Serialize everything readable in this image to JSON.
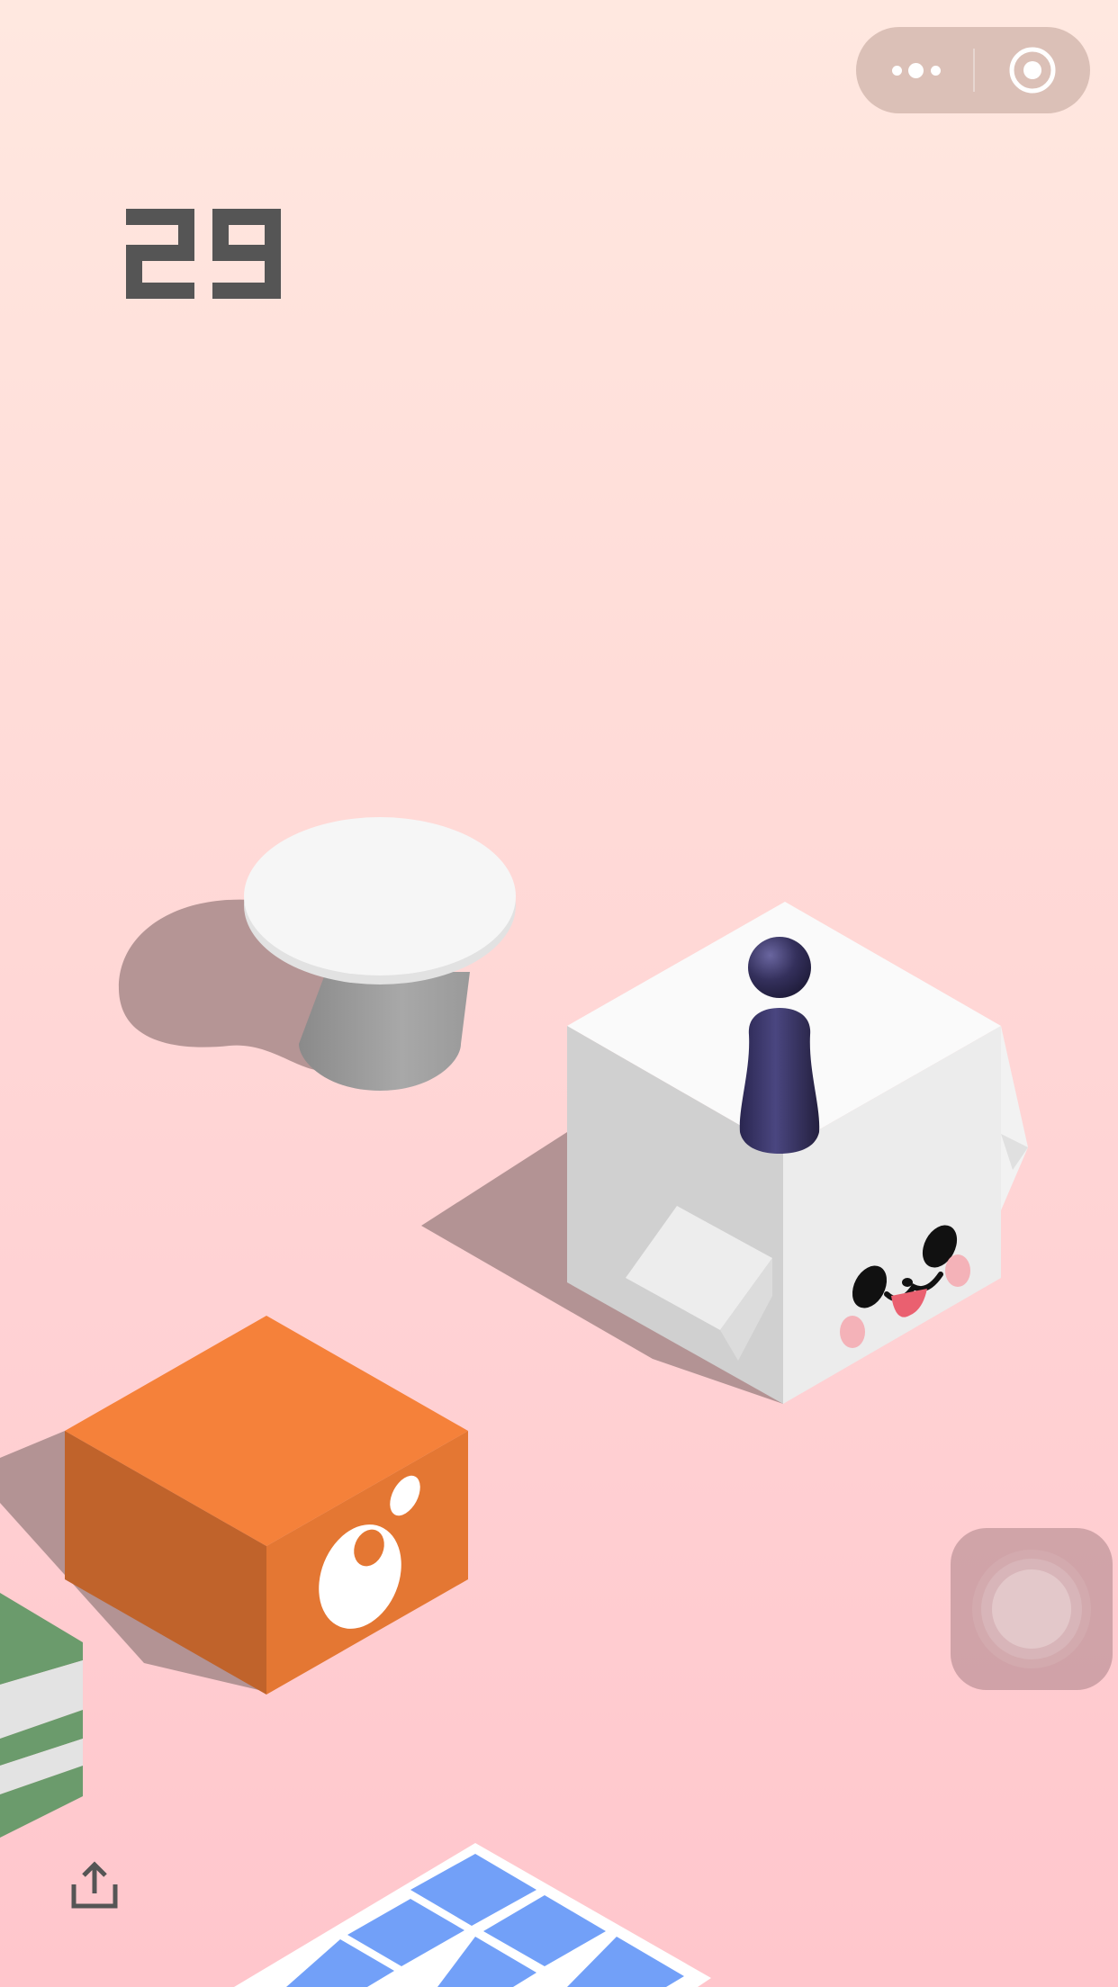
{
  "game": {
    "score": "29"
  },
  "capsule": {
    "more_icon": "more-dots-icon",
    "close_icon": "target-close-icon"
  },
  "controls": {
    "float_button_icon": "assistive-touch-icon",
    "share_icon": "share-icon"
  },
  "colors": {
    "background_top": "#ffe8e0",
    "background_bottom": "#ffc6cc",
    "score": "#555555",
    "orange_block": "#f4803a",
    "blue_tile": "#72a0f8",
    "green_block": "#6a9a6c",
    "player": "#3a3560"
  }
}
